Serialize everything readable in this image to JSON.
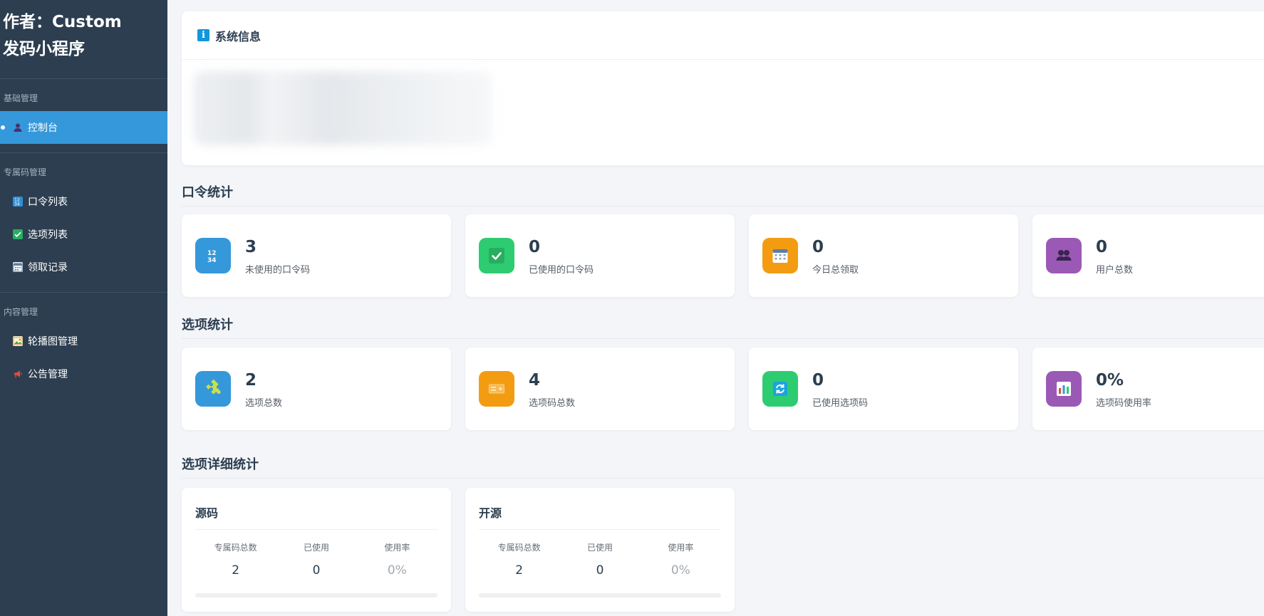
{
  "sidebar": {
    "brand_line1": "作者：Custom",
    "brand_line2": "发码小程序",
    "sections": [
      {
        "title": "基础管理",
        "items": [
          {
            "label": "控制台",
            "icon": "user-icon",
            "active": true
          }
        ]
      },
      {
        "title": "专属码管理",
        "items": [
          {
            "label": "口令列表",
            "icon": "number-list-icon"
          },
          {
            "label": "选项列表",
            "icon": "checkbox-icon"
          },
          {
            "label": "领取记录",
            "icon": "calendar-icon"
          }
        ]
      },
      {
        "title": "内容管理",
        "items": [
          {
            "label": "轮播图管理",
            "icon": "image-icon"
          },
          {
            "label": "公告管理",
            "icon": "megaphone-icon"
          }
        ]
      }
    ]
  },
  "system_info": {
    "title": "系统信息",
    "icon": "info-icon"
  },
  "token_stats": {
    "heading": "口令统计",
    "cards": [
      {
        "value": "3",
        "label": "未使用的口令码",
        "icon": "numbers-icon",
        "color": "#3498db"
      },
      {
        "value": "0",
        "label": "已使用的口令码",
        "icon": "checkmark-icon",
        "color": "#2ecc71"
      },
      {
        "value": "0",
        "label": "今日总领取",
        "icon": "calendar-icon",
        "color": "#f39c12"
      },
      {
        "value": "0",
        "label": "用户总数",
        "icon": "users-icon",
        "color": "#9b59b6"
      }
    ]
  },
  "option_stats": {
    "heading": "选项统计",
    "cards": [
      {
        "value": "2",
        "label": "选项总数",
        "icon": "puzzle-icon",
        "color": "#3498db"
      },
      {
        "value": "4",
        "label": "选项码总数",
        "icon": "ticket-icon",
        "color": "#f39c12"
      },
      {
        "value": "0",
        "label": "已使用选项码",
        "icon": "refresh-icon",
        "color": "#2ecc71"
      },
      {
        "value": "0%",
        "label": "选项码使用率",
        "icon": "bar-chart-icon",
        "color": "#9b59b6"
      }
    ]
  },
  "option_details": {
    "heading": "选项详细统计",
    "columns": [
      "专属码总数",
      "已使用",
      "使用率"
    ],
    "items": [
      {
        "name": "源码",
        "total": "2",
        "used": "0",
        "rate": "0%",
        "progress": 0
      },
      {
        "name": "开源",
        "total": "2",
        "used": "0",
        "rate": "0%",
        "progress": 0
      }
    ]
  }
}
